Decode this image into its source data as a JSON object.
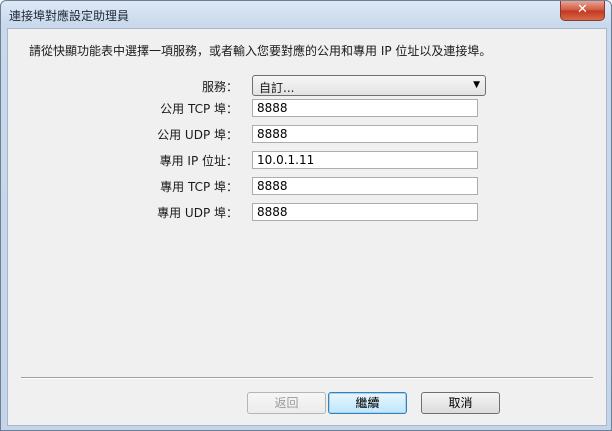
{
  "window": {
    "title": "連接埠對應設定助理員",
    "close_glyph": "✕"
  },
  "instruction": "請從快顯功能表中選擇一項服務，或者輸入您要對應的公用和專用 IP 位址以及連接埠。",
  "service": {
    "label": "服務：",
    "value": "自訂..."
  },
  "fields": [
    {
      "label": "公用 TCP 埠：",
      "value": "8888"
    },
    {
      "label": "公用 UDP 埠：",
      "value": "8888"
    },
    {
      "label": "專用 IP 位址：",
      "value": "10.0.1.11"
    },
    {
      "label": "專用 TCP 埠：",
      "value": "8888"
    },
    {
      "label": "專用 UDP 埠：",
      "value": "8888"
    }
  ],
  "buttons": {
    "back": "返回",
    "continue": "繼續",
    "cancel": "取消"
  }
}
